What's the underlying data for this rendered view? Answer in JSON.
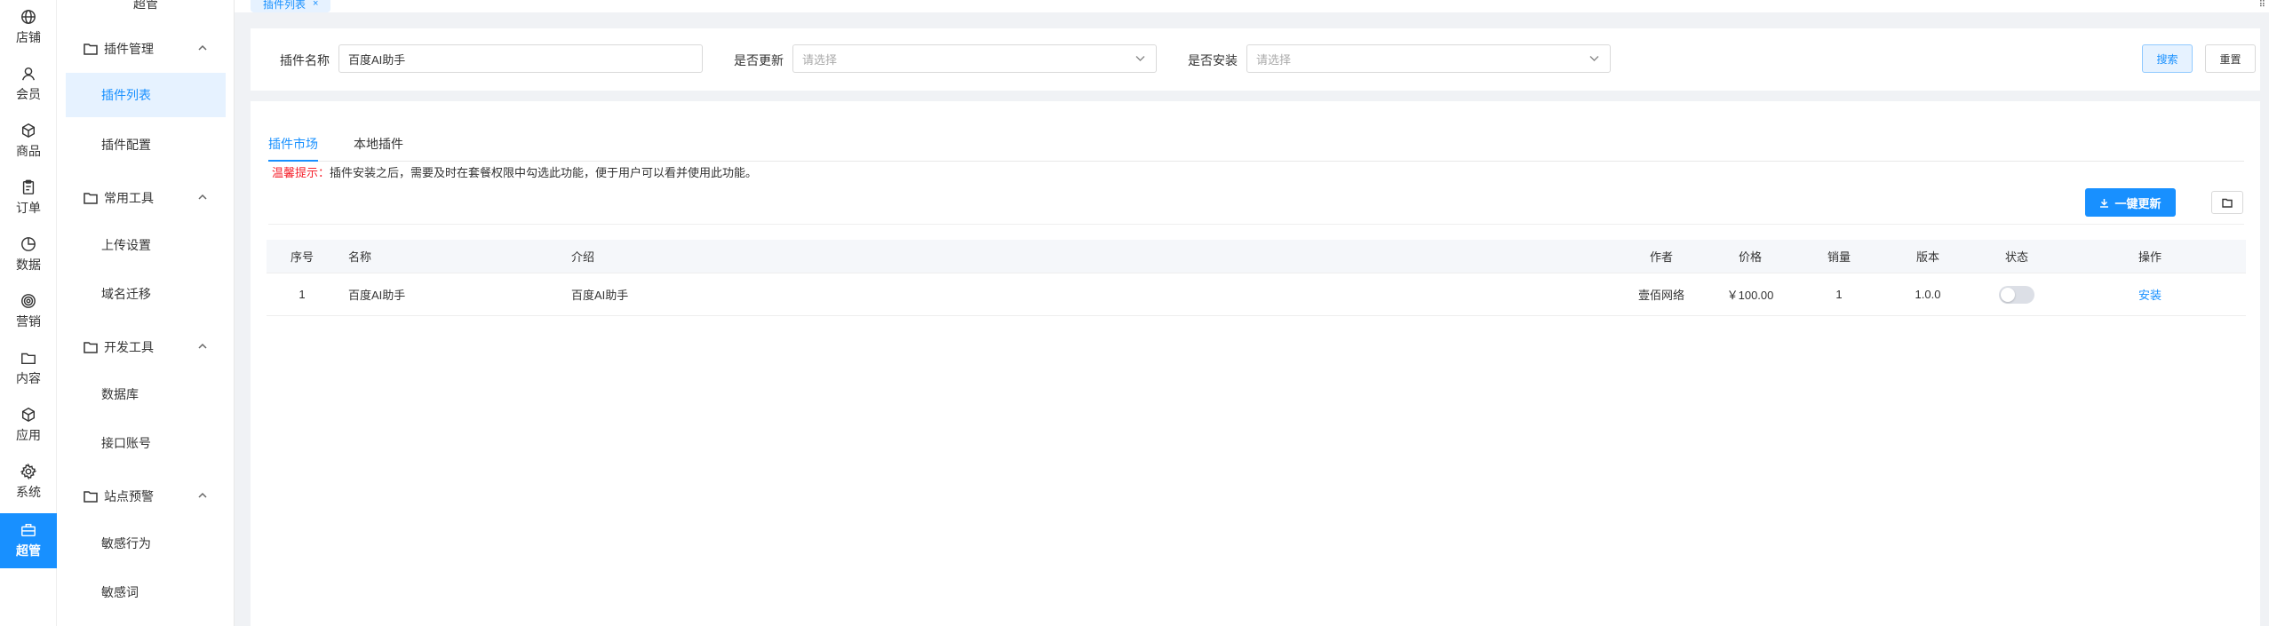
{
  "rail": [
    {
      "icon": "globe-icon",
      "label": "店铺"
    },
    {
      "icon": "user-icon",
      "label": "会员"
    },
    {
      "icon": "box-icon",
      "label": "商品"
    },
    {
      "icon": "clipboard-icon",
      "label": "订单"
    },
    {
      "icon": "chart-icon",
      "label": "数据"
    },
    {
      "icon": "target-icon",
      "label": "营销"
    },
    {
      "icon": "folder-icon",
      "label": "内容"
    },
    {
      "icon": "cube-icon",
      "label": "应用"
    },
    {
      "icon": "gear-icon",
      "label": "系统"
    },
    {
      "icon": "briefcase-icon",
      "label": "超管"
    }
  ],
  "menu": {
    "top_label": "超管",
    "groups": [
      {
        "label": "插件管理",
        "items": [
          "插件列表",
          "插件配置"
        ]
      },
      {
        "label": "常用工具",
        "items": [
          "上传设置",
          "域名迁移"
        ]
      },
      {
        "label": "开发工具",
        "items": [
          "数据库",
          "接口账号"
        ]
      },
      {
        "label": "站点预警",
        "items": [
          "敏感行为",
          "敏感词"
        ]
      }
    ]
  },
  "tabbar": {
    "tab_label": "插件列表",
    "close": "×",
    "corner": "⠿"
  },
  "search": {
    "name_label": "插件名称",
    "name_value": "百度AI助手",
    "update_label": "是否更新",
    "update_placeholder": "请选择",
    "install_label": "是否安装",
    "install_placeholder": "请选择",
    "search_btn": "搜索",
    "reset_btn": "重置"
  },
  "main": {
    "tabs": [
      "插件市场",
      "本地插件"
    ],
    "notice_prefix": "温馨提示：",
    "notice_text": "插件安装之后，需要及时在套餐权限中勾选此功能，便于用户可以看并使用此功能。",
    "update_btn": "一键更新",
    "columns": [
      "序号",
      "名称",
      "介绍",
      "作者",
      "价格",
      "销量",
      "版本",
      "状态",
      "操作"
    ],
    "rows": [
      {
        "index": "1",
        "name": "百度AI助手",
        "intro": "百度AI助手",
        "author": "壹佰网络",
        "price": "￥100.00",
        "sales": "1",
        "version": "1.0.0",
        "status": "off",
        "action": "安装"
      }
    ]
  },
  "colors": {
    "accent": "#1890ff",
    "warn": "#f5222d"
  }
}
